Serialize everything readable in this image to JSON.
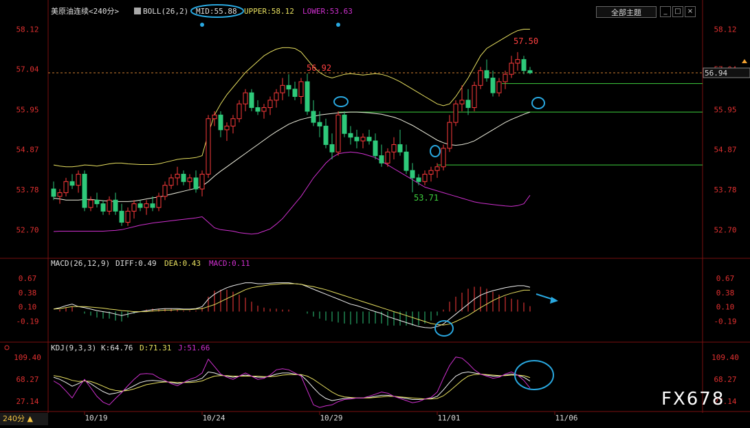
{
  "header": {
    "instrument": "美原油连续<240分>",
    "boll_label": "BOLL(26,2)",
    "mid_label": "MID:55.88",
    "upper_label": "UPPER:58.12",
    "lower_label": "LOWER:53.63"
  },
  "macd_header": {
    "name": "MACD(26,12,9)",
    "diff": "DIFF:0.49",
    "dea": "DEA:0.43",
    "macd": "MACD:0.11"
  },
  "kdj_header": {
    "name": "KDJ(9,3,3)",
    "k": "K:64.76",
    "d": "D:71.31",
    "j": "J:51.66"
  },
  "theme_button": "全部主题",
  "window_buttons": [
    "_",
    "□",
    "×"
  ],
  "period_label": "240分 ▲",
  "watermark": "FX678",
  "colors": {
    "up": "#ff3b3b",
    "down": "#2ec97a",
    "boll_upper": "#e8e060",
    "boll_mid": "#f0f0e0",
    "boll_lower": "#d030d0",
    "diff": "#f0f0f0",
    "dea": "#e8e060",
    "j_line": "#d030d0",
    "annotation": "#29a8e0",
    "support_line": "#3ed13e",
    "price_dash": "#d08030"
  },
  "chart_data": [
    {
      "type": "candlestick",
      "title": "美原油连续<240分>",
      "ylim": [
        52.0,
        58.5
      ],
      "y_ticks": [
        "58.12",
        "57.04",
        "55.95",
        "54.87",
        "53.78",
        "52.70"
      ],
      "x_ticks": [
        "10/19",
        "10/24",
        "10/29",
        "11/01",
        "11/06"
      ],
      "x_tick_index": [
        5,
        24,
        43,
        62,
        81
      ],
      "annotations": {
        "high_1": "56.92",
        "high_2": "57.50",
        "low_1": "53.71",
        "last_price": "56.94"
      },
      "ohlc": [
        [
          53.8,
          54.0,
          53.5,
          53.6
        ],
        [
          53.6,
          53.8,
          53.4,
          53.7
        ],
        [
          53.7,
          54.1,
          53.6,
          54.0
        ],
        [
          54.0,
          54.2,
          53.8,
          53.9
        ],
        [
          53.9,
          54.3,
          53.7,
          54.2
        ],
        [
          54.2,
          54.3,
          53.2,
          53.3
        ],
        [
          53.3,
          53.6,
          53.2,
          53.5
        ],
        [
          53.5,
          53.7,
          53.3,
          53.4
        ],
        [
          53.4,
          53.5,
          53.1,
          53.2
        ],
        [
          53.2,
          53.6,
          53.1,
          53.5
        ],
        [
          53.5,
          53.7,
          53.1,
          53.2
        ],
        [
          53.2,
          53.4,
          52.8,
          52.9
        ],
        [
          52.9,
          53.3,
          52.8,
          53.2
        ],
        [
          53.2,
          53.5,
          53.0,
          53.4
        ],
        [
          53.4,
          53.5,
          53.2,
          53.3
        ],
        [
          53.3,
          53.5,
          53.1,
          53.4
        ],
        [
          53.4,
          53.6,
          53.2,
          53.3
        ],
        [
          53.3,
          53.7,
          53.2,
          53.6
        ],
        [
          53.6,
          54.0,
          53.5,
          53.9
        ],
        [
          53.9,
          54.2,
          53.8,
          54.1
        ],
        [
          54.1,
          54.4,
          53.9,
          54.2
        ],
        [
          54.2,
          54.3,
          53.9,
          54.0
        ],
        [
          54.0,
          54.2,
          53.8,
          54.1
        ],
        [
          54.1,
          54.3,
          53.7,
          53.8
        ],
        [
          53.8,
          54.3,
          53.6,
          54.2
        ],
        [
          54.2,
          55.8,
          54.1,
          55.7
        ],
        [
          55.7,
          55.9,
          55.5,
          55.8
        ],
        [
          55.8,
          55.9,
          55.2,
          55.4
        ],
        [
          55.4,
          55.6,
          55.1,
          55.5
        ],
        [
          55.5,
          55.8,
          55.3,
          55.7
        ],
        [
          55.7,
          56.2,
          55.6,
          56.1
        ],
        [
          56.1,
          56.5,
          55.9,
          56.4
        ],
        [
          56.4,
          56.5,
          55.9,
          56.0
        ],
        [
          56.0,
          56.2,
          55.8,
          55.9
        ],
        [
          55.9,
          56.1,
          55.7,
          56.0
        ],
        [
          56.0,
          56.3,
          55.8,
          56.2
        ],
        [
          56.2,
          56.5,
          56.0,
          56.4
        ],
        [
          56.4,
          56.8,
          56.2,
          56.6
        ],
        [
          56.6,
          56.9,
          56.3,
          56.5
        ],
        [
          56.5,
          56.7,
          56.2,
          56.3
        ],
        [
          56.3,
          56.8,
          56.1,
          56.7
        ],
        [
          56.7,
          56.92,
          55.8,
          55.9
        ],
        [
          55.9,
          56.2,
          55.5,
          55.6
        ],
        [
          55.6,
          55.9,
          55.2,
          55.5
        ],
        [
          55.5,
          55.7,
          54.9,
          55.0
        ],
        [
          55.0,
          55.3,
          54.6,
          54.8
        ],
        [
          54.8,
          55.9,
          54.7,
          55.8
        ],
        [
          55.8,
          55.9,
          55.2,
          55.3
        ],
        [
          55.3,
          55.5,
          55.0,
          55.2
        ],
        [
          55.2,
          55.4,
          54.9,
          55.1
        ],
        [
          55.1,
          55.3,
          54.9,
          55.2
        ],
        [
          55.2,
          55.4,
          55.0,
          55.1
        ],
        [
          55.1,
          55.3,
          54.6,
          54.7
        ],
        [
          54.7,
          55.0,
          54.4,
          54.5
        ],
        [
          54.5,
          54.9,
          54.4,
          54.8
        ],
        [
          54.8,
          55.2,
          54.6,
          55.0
        ],
        [
          55.0,
          55.4,
          54.7,
          54.8
        ],
        [
          54.8,
          55.0,
          54.2,
          54.3
        ],
        [
          54.3,
          54.5,
          53.71,
          54.1
        ],
        [
          54.1,
          54.2,
          53.9,
          54.0
        ],
        [
          54.0,
          54.3,
          53.9,
          54.2
        ],
        [
          54.2,
          54.4,
          54.0,
          54.3
        ],
        [
          54.3,
          54.5,
          54.1,
          54.4
        ],
        [
          54.4,
          55.0,
          54.3,
          54.9
        ],
        [
          54.9,
          55.8,
          54.8,
          55.6
        ],
        [
          55.6,
          56.2,
          55.5,
          56.1
        ],
        [
          56.1,
          56.6,
          55.9,
          56.2
        ],
        [
          56.2,
          56.5,
          55.8,
          56.0
        ],
        [
          56.0,
          56.7,
          55.9,
          56.6
        ],
        [
          56.6,
          57.1,
          56.5,
          57.0
        ],
        [
          57.0,
          57.3,
          56.7,
          56.8
        ],
        [
          56.8,
          57.0,
          56.3,
          56.4
        ],
        [
          56.4,
          56.8,
          56.3,
          56.7
        ],
        [
          56.7,
          57.0,
          56.5,
          56.9
        ],
        [
          56.9,
          57.4,
          56.8,
          57.2
        ],
        [
          57.2,
          57.5,
          57.0,
          57.3
        ],
        [
          57.3,
          57.4,
          56.9,
          57.0
        ],
        [
          57.0,
          57.1,
          56.9,
          56.94
        ]
      ],
      "boll_upper": [
        54.45,
        54.42,
        54.4,
        54.4,
        54.42,
        54.45,
        54.44,
        54.42,
        54.45,
        54.48,
        54.5,
        54.5,
        54.48,
        54.47,
        54.46,
        54.46,
        54.46,
        54.48,
        54.52,
        54.56,
        54.6,
        54.62,
        54.63,
        54.65,
        54.7,
        55.3,
        55.8,
        56.1,
        56.35,
        56.55,
        56.75,
        56.95,
        57.1,
        57.25,
        57.4,
        57.5,
        57.58,
        57.62,
        57.62,
        57.6,
        57.5,
        57.3,
        57.1,
        56.95,
        56.85,
        56.8,
        56.85,
        56.9,
        56.92,
        56.9,
        56.88,
        56.9,
        56.92,
        56.9,
        56.85,
        56.78,
        56.7,
        56.6,
        56.5,
        56.4,
        56.3,
        56.2,
        56.1,
        56.05,
        56.1,
        56.3,
        56.55,
        56.8,
        57.1,
        57.4,
        57.6,
        57.7,
        57.8,
        57.9,
        58.0,
        58.08,
        58.12,
        58.12
      ],
      "boll_mid": [
        53.55,
        53.53,
        53.5,
        53.5,
        53.5,
        53.52,
        53.52,
        53.5,
        53.48,
        53.47,
        53.46,
        53.46,
        53.46,
        53.47,
        53.5,
        53.53,
        53.56,
        53.58,
        53.62,
        53.66,
        53.7,
        53.74,
        53.78,
        53.82,
        53.88,
        54.0,
        54.15,
        54.28,
        54.4,
        54.52,
        54.64,
        54.76,
        54.88,
        55.0,
        55.12,
        55.24,
        55.35,
        55.45,
        55.55,
        55.62,
        55.68,
        55.72,
        55.76,
        55.8,
        55.82,
        55.84,
        55.86,
        55.87,
        55.88,
        55.88,
        55.87,
        55.86,
        55.84,
        55.82,
        55.78,
        55.74,
        55.68,
        55.6,
        55.52,
        55.42,
        55.32,
        55.22,
        55.12,
        55.05,
        55.0,
        54.98,
        55.0,
        55.04,
        55.1,
        55.2,
        55.3,
        55.4,
        55.5,
        55.6,
        55.68,
        55.75,
        55.82,
        55.88
      ],
      "boll_lower": [
        52.65,
        52.66,
        52.66,
        52.66,
        52.66,
        52.66,
        52.66,
        52.66,
        52.66,
        52.67,
        52.68,
        52.7,
        52.74,
        52.78,
        52.82,
        52.85,
        52.88,
        52.9,
        52.92,
        52.94,
        52.96,
        52.98,
        53.0,
        53.02,
        53.05,
        52.9,
        52.75,
        52.7,
        52.68,
        52.66,
        52.62,
        52.6,
        52.58,
        52.6,
        52.66,
        52.72,
        52.85,
        53.0,
        53.2,
        53.4,
        53.6,
        53.85,
        54.1,
        54.3,
        54.5,
        54.65,
        54.75,
        54.78,
        54.8,
        54.78,
        54.75,
        54.7,
        54.65,
        54.55,
        54.45,
        54.35,
        54.25,
        54.15,
        54.05,
        53.95,
        53.85,
        53.8,
        53.75,
        53.7,
        53.65,
        53.6,
        53.55,
        53.5,
        53.45,
        53.42,
        53.4,
        53.38,
        53.36,
        53.34,
        53.33,
        53.35,
        53.4,
        53.63
      ]
    },
    {
      "type": "macd",
      "title": "MACD(26,12,9)",
      "ylim": [
        -0.6,
        0.85
      ],
      "y_ticks": [
        "0.67",
        "0.38",
        "0.10",
        "-0.19"
      ],
      "diff": [
        0.05,
        0.08,
        0.12,
        0.15,
        0.1,
        0.08,
        0.05,
        0.02,
        0.0,
        -0.02,
        -0.05,
        -0.08,
        -0.05,
        -0.02,
        0.0,
        0.02,
        0.04,
        0.05,
        0.06,
        0.06,
        0.06,
        0.05,
        0.05,
        0.06,
        0.1,
        0.25,
        0.35,
        0.42,
        0.48,
        0.52,
        0.55,
        0.58,
        0.58,
        0.56,
        0.56,
        0.57,
        0.58,
        0.58,
        0.58,
        0.56,
        0.55,
        0.5,
        0.45,
        0.4,
        0.35,
        0.3,
        0.25,
        0.2,
        0.15,
        0.12,
        0.08,
        0.04,
        0.0,
        -0.04,
        -0.1,
        -0.14,
        -0.18,
        -0.22,
        -0.26,
        -0.3,
        -0.32,
        -0.33,
        -0.3,
        -0.25,
        -0.15,
        -0.05,
        0.05,
        0.15,
        0.25,
        0.33,
        0.38,
        0.42,
        0.45,
        0.48,
        0.5,
        0.52,
        0.52,
        0.49
      ],
      "dea": [
        0.05,
        0.06,
        0.08,
        0.1,
        0.1,
        0.1,
        0.09,
        0.08,
        0.07,
        0.05,
        0.04,
        0.02,
        0.01,
        0.0,
        0.0,
        0.0,
        0.01,
        0.02,
        0.03,
        0.03,
        0.04,
        0.04,
        0.04,
        0.05,
        0.06,
        0.1,
        0.14,
        0.2,
        0.26,
        0.32,
        0.38,
        0.44,
        0.48,
        0.5,
        0.52,
        0.54,
        0.55,
        0.56,
        0.56,
        0.56,
        0.55,
        0.52,
        0.5,
        0.47,
        0.44,
        0.4,
        0.36,
        0.32,
        0.28,
        0.24,
        0.2,
        0.16,
        0.12,
        0.08,
        0.04,
        0.0,
        -0.04,
        -0.08,
        -0.12,
        -0.16,
        -0.2,
        -0.24,
        -0.26,
        -0.27,
        -0.25,
        -0.2,
        -0.14,
        -0.08,
        0.0,
        0.08,
        0.15,
        0.22,
        0.28,
        0.33,
        0.37,
        0.4,
        0.43,
        0.43
      ],
      "macd": [
        0.0,
        0.04,
        0.08,
        0.1,
        0.0,
        -0.04,
        -0.08,
        -0.12,
        -0.14,
        -0.14,
        -0.18,
        -0.2,
        -0.12,
        -0.04,
        0.0,
        0.04,
        0.06,
        0.06,
        0.06,
        0.06,
        0.04,
        0.02,
        0.02,
        0.02,
        0.08,
        0.3,
        0.42,
        0.44,
        0.44,
        0.4,
        0.34,
        0.28,
        0.2,
        0.12,
        0.08,
        0.06,
        0.06,
        0.04,
        0.04,
        0.0,
        0.0,
        -0.04,
        -0.1,
        -0.14,
        -0.18,
        -0.2,
        -0.22,
        -0.24,
        -0.26,
        -0.24,
        -0.24,
        -0.24,
        -0.24,
        -0.24,
        -0.28,
        -0.28,
        -0.28,
        -0.28,
        -0.28,
        -0.28,
        -0.24,
        -0.18,
        -0.08,
        0.04,
        0.2,
        0.3,
        0.38,
        0.46,
        0.5,
        0.5,
        0.46,
        0.4,
        0.34,
        0.3,
        0.26,
        0.24,
        0.18,
        0.11
      ]
    },
    {
      "type": "kdj",
      "title": "KDJ(9,3,3)",
      "ylim": [
        10,
        120
      ],
      "y_ticks": [
        "109.40",
        "68.27",
        "27.14"
      ],
      "k": [
        72,
        68,
        62,
        55,
        60,
        66,
        60,
        52,
        45,
        40,
        42,
        45,
        50,
        56,
        62,
        65,
        66,
        65,
        64,
        62,
        60,
        62,
        64,
        66,
        70,
        82,
        80,
        76,
        74,
        72,
        74,
        76,
        74,
        72,
        72,
        74,
        78,
        80,
        80,
        78,
        76,
        65,
        52,
        40,
        32,
        28,
        30,
        32,
        33,
        33,
        33,
        34,
        36,
        38,
        38,
        36,
        34,
        32,
        30,
        30,
        31,
        32,
        36,
        48,
        62,
        74,
        80,
        82,
        80,
        78,
        76,
        74,
        74,
        76,
        78,
        76,
        72,
        64.76
      ],
      "d": [
        75,
        73,
        70,
        66,
        64,
        65,
        64,
        60,
        55,
        50,
        47,
        46,
        47,
        50,
        54,
        58,
        60,
        62,
        63,
        63,
        62,
        62,
        62,
        63,
        65,
        70,
        74,
        75,
        75,
        74,
        74,
        74,
        74,
        74,
        73,
        73,
        74,
        76,
        77,
        77,
        77,
        74,
        68,
        60,
        52,
        44,
        38,
        35,
        34,
        33,
        33,
        33,
        34,
        35,
        36,
        36,
        35,
        34,
        33,
        32,
        31,
        31,
        32,
        37,
        46,
        56,
        66,
        74,
        77,
        78,
        77,
        76,
        75,
        75,
        76,
        76,
        75,
        71.31
      ],
      "j": [
        65,
        58,
        46,
        33,
        52,
        68,
        52,
        36,
        25,
        20,
        32,
        43,
        56,
        68,
        78,
        79,
        78,
        71,
        66,
        60,
        56,
        62,
        68,
        72,
        80,
        106,
        92,
        78,
        72,
        68,
        74,
        80,
        74,
        68,
        70,
        76,
        86,
        88,
        86,
        80,
        74,
        47,
        20,
        15,
        18,
        20,
        26,
        30,
        31,
        33,
        33,
        36,
        40,
        44,
        42,
        36,
        32,
        28,
        24,
        26,
        31,
        34,
        44,
        70,
        94,
        110,
        108,
        98,
        86,
        78,
        74,
        70,
        72,
        78,
        82,
        76,
        66,
        51.66
      ]
    }
  ]
}
